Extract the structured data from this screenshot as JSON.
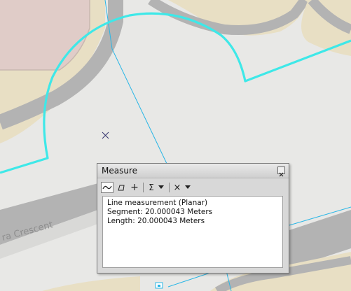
{
  "map": {
    "street_label": "ra Crescent",
    "colors": {
      "background": "#e8e8e6",
      "parcel_fill": "#e8dfc4",
      "building_fill": "#e0ccc8",
      "road_fill": "#b3b3b3",
      "measure_line": "#3ee8e8",
      "thin_line": "#29b6e6",
      "cursor": "#33336e"
    },
    "icons": [
      "crosshair-cursor-icon"
    ]
  },
  "measure_window": {
    "title": "Measure",
    "toolbar": {
      "items": [
        {
          "name": "measure-line-tool",
          "icon": "line-icon"
        },
        {
          "name": "measure-area-tool",
          "icon": "polygon-icon"
        },
        {
          "name": "measure-feature-tool",
          "icon": "plus-icon"
        },
        {
          "name": "show-total-tool",
          "icon": "sigma-icon"
        },
        {
          "name": "clear-and-reset-tool",
          "icon": "x-icon"
        }
      ],
      "sigma": "Σ",
      "plus": "+",
      "clear": "×"
    },
    "results": {
      "line1": "Line measurement (Planar)",
      "line2": "Segment: 20.000043 Meters",
      "line3": "Length: 20.000043 Meters"
    }
  }
}
